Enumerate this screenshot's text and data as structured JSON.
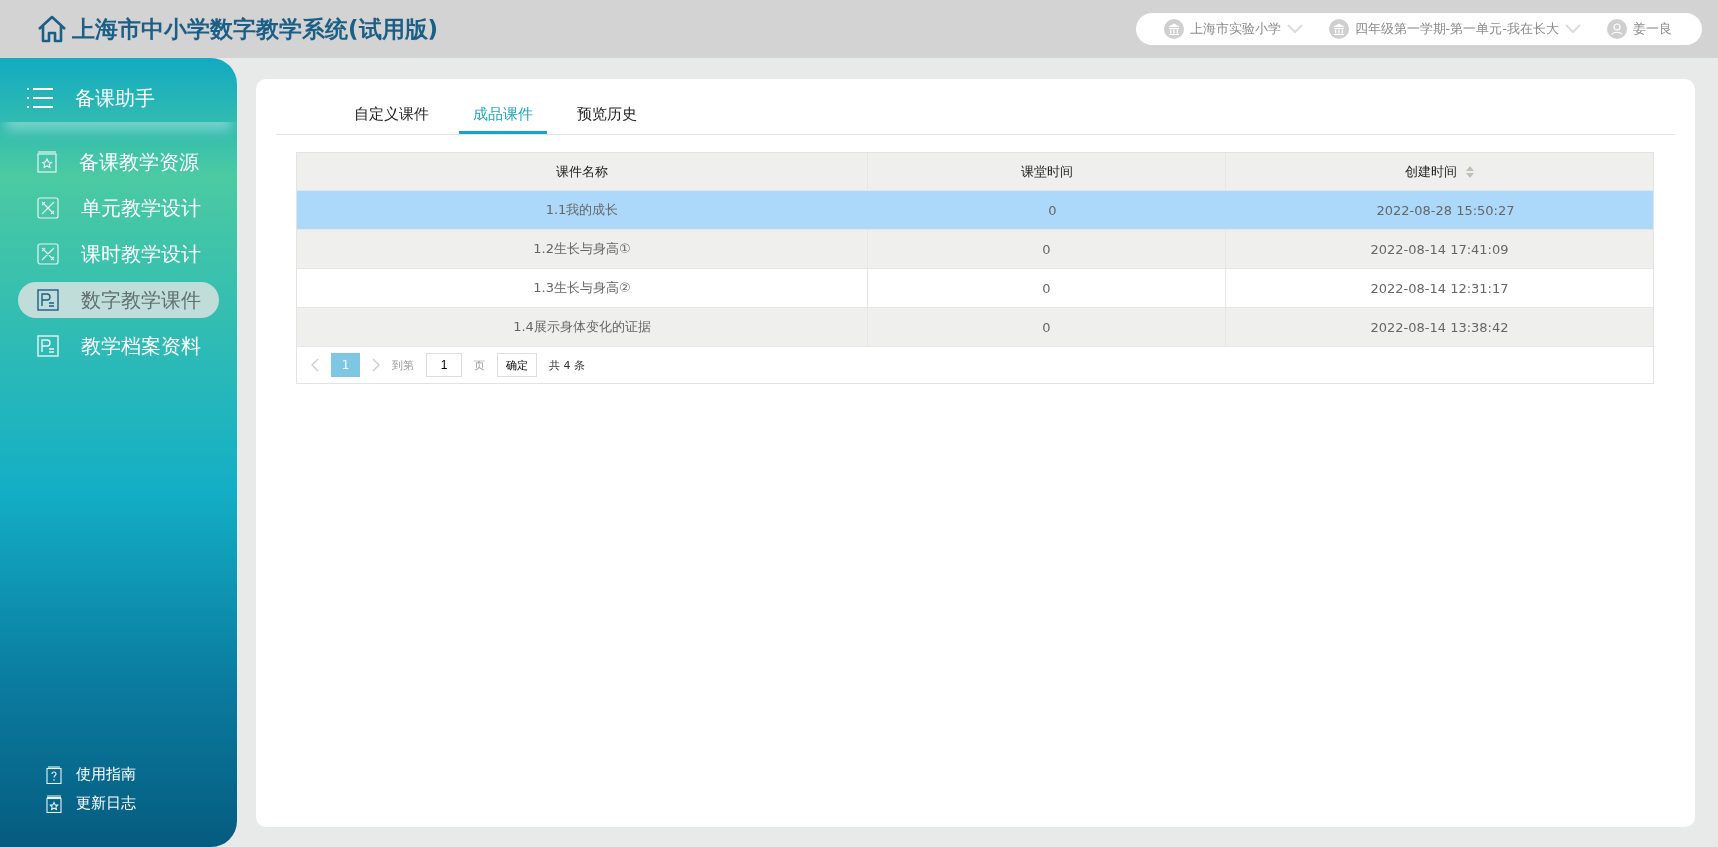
{
  "header": {
    "title": "上海市中小学数字教学系统(试用版)",
    "selectors": [
      {
        "kind": "school",
        "label": "上海市实验小学",
        "dropdown": true
      },
      {
        "kind": "school",
        "label": "四年级第一学期-第一单元-我在长大",
        "dropdown": true
      },
      {
        "kind": "user",
        "label": "姜一良",
        "dropdown": false
      }
    ]
  },
  "sidebar": {
    "title": "备课助手",
    "items": [
      {
        "label": "备课教学资源",
        "kind": "resource",
        "selected": false
      },
      {
        "label": "单元教学设计",
        "kind": "design",
        "selected": false
      },
      {
        "label": "课时教学设计",
        "kind": "design",
        "selected": false
      },
      {
        "label": "数字教学课件",
        "kind": "courseware",
        "selected": true
      },
      {
        "label": "教学档案资料",
        "kind": "courseware",
        "selected": false
      }
    ],
    "footer": [
      {
        "label": "使用指南",
        "kind": "guide"
      },
      {
        "label": "更新日志",
        "kind": "changelog"
      }
    ]
  },
  "tabs": [
    {
      "label": "自定义课件",
      "selected": false
    },
    {
      "label": "成品课件",
      "selected": true
    },
    {
      "label": "预览历史",
      "selected": false
    }
  ],
  "table": {
    "columns": [
      {
        "label": "课件名称",
        "sortable": false
      },
      {
        "label": "课堂时间",
        "sortable": false
      },
      {
        "label": "创建时间",
        "sortable": true
      }
    ],
    "rows": [
      {
        "cells": [
          "1.1我的成长",
          "0",
          "2022-08-28 15:50:27"
        ],
        "selected": true
      },
      {
        "cells": [
          "1.2生长与身高①",
          "0",
          "2022-08-14 17:41:09"
        ],
        "selected": false
      },
      {
        "cells": [
          "1.3生长与身高②",
          "0",
          "2022-08-14 12:31:17"
        ],
        "selected": false
      },
      {
        "cells": [
          "1.4展示身体变化的证据",
          "0",
          "2022-08-14 13:38:42"
        ],
        "selected": false
      }
    ]
  },
  "pagination": {
    "pages": [
      {
        "label": "1",
        "selected": true
      }
    ],
    "goto_label": "到第",
    "goto_value": "1",
    "page_unit": "页",
    "confirm": "确定",
    "total": "共 4 条"
  }
}
